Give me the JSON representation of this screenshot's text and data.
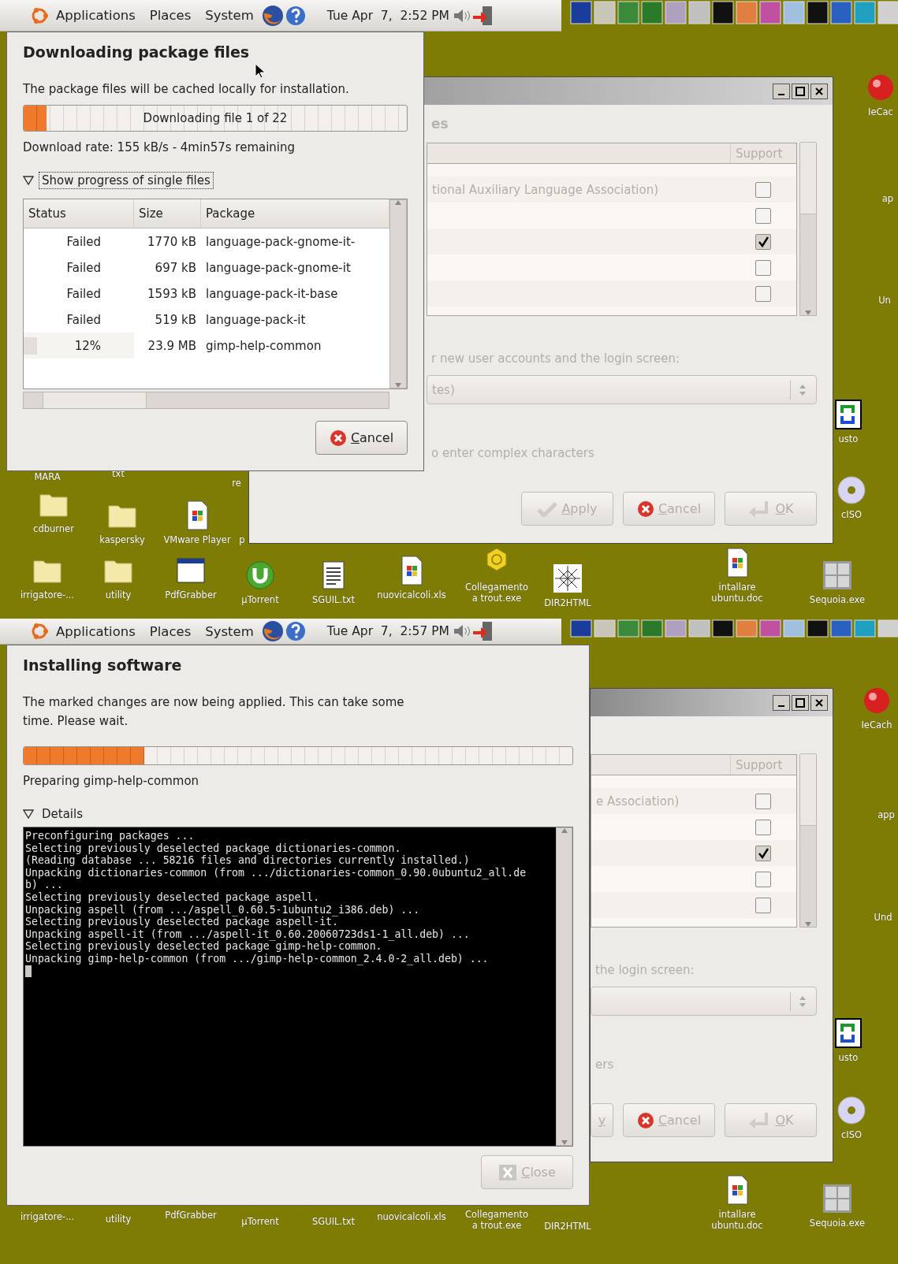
{
  "screens": [
    {
      "panel": {
        "menus": [
          "Applications",
          "Places",
          "System"
        ],
        "clock": "Tue Apr  7,  2:52 PM"
      },
      "desktop_icons": [
        {
          "label": "IeCac",
          "kind": "ball"
        },
        {
          "label": "ap",
          "kind": "none"
        },
        {
          "label": "Un",
          "kind": "none"
        },
        {
          "label": "usto",
          "kind": "logo"
        },
        {
          "label": "cISO",
          "kind": "disc"
        },
        {
          "label": "MARA",
          "kind": "none"
        },
        {
          "label": "txt",
          "kind": "none"
        },
        {
          "label": "re",
          "kind": "none"
        },
        {
          "label": "cdburner",
          "kind": "folder"
        },
        {
          "label": "kaspersky",
          "kind": "folder"
        },
        {
          "label": "VMware Player",
          "kind": "document"
        },
        {
          "label": "p",
          "kind": "none"
        },
        {
          "label": "irrigatore-...",
          "kind": "folder"
        },
        {
          "label": "utility",
          "kind": "folder"
        },
        {
          "label": "PdfGrabber",
          "kind": "window"
        },
        {
          "label": "µTorrent",
          "kind": "torrent"
        },
        {
          "label": "SGUIL.txt",
          "kind": "textfile"
        },
        {
          "label": "nuovicalcoli.xls",
          "kind": "document"
        },
        {
          "label": "Collegamento a trout.exe",
          "kind": "gear"
        },
        {
          "label": "DIR2HTML",
          "kind": "web"
        },
        {
          "label": "intallare ubuntu.doc",
          "kind": "document"
        },
        {
          "label": "Sequoia.exe",
          "kind": "grid"
        }
      ],
      "background_window": {
        "heading": "es",
        "support_header": "Support",
        "rows": [
          {
            "label": "tional Auxiliary Language Association)",
            "checked": false
          },
          {
            "checked": false
          },
          {
            "checked": true
          },
          {
            "checked": false
          },
          {
            "checked": false
          }
        ],
        "prompt": "r new user accounts and the login screen:",
        "combo_value": "tes)",
        "hint": "o enter complex characters",
        "buttons": [
          {
            "label": "Apply",
            "kind": "apply",
            "disabled": true
          },
          {
            "label": "Cancel",
            "kind": "cancel",
            "disabled": true
          },
          {
            "label": "OK",
            "kind": "ok",
            "disabled": true
          }
        ]
      },
      "dialog": {
        "kind": "download",
        "title": "Downloading package files",
        "description": "The package files will be cached locally for installation.",
        "progress": {
          "label": "Downloading file 1 of 22",
          "level": 0.06
        },
        "status": "Download rate: 155 kB/s - 4min57s remaining",
        "expander": {
          "label": "Show progress of single files",
          "expanded": true
        },
        "files": {
          "columns": [
            "Status",
            "Size",
            "Package"
          ],
          "rows": [
            {
              "status": "Failed",
              "size": "1770 kB",
              "package": "language-pack-gnome-it-"
            },
            {
              "status": "Failed",
              "size": "697 kB",
              "package": "language-pack-gnome-it"
            },
            {
              "status": "Failed",
              "size": "1593 kB",
              "package": "language-pack-it-base"
            },
            {
              "status": "Failed",
              "size": "519 kB",
              "package": "language-pack-it"
            },
            {
              "status": "12%",
              "level": 0.12,
              "size": "23.9 MB",
              "package": "gimp-help-common"
            }
          ]
        },
        "button": {
          "label": "Cancel",
          "kind": "cancel",
          "disabled": false
        }
      }
    },
    {
      "panel": {
        "menus": [
          "Applications",
          "Places",
          "System"
        ],
        "clock": "Tue Apr  7,  2:57 PM"
      },
      "desktop_icons": [
        {
          "label": "IeCach",
          "kind": "ball"
        },
        {
          "label": "app",
          "kind": "none"
        },
        {
          "label": "Und",
          "kind": "none"
        },
        {
          "label": "usto",
          "kind": "logo"
        },
        {
          "label": "cISO",
          "kind": "disc"
        },
        {
          "label": "irrigatore-...",
          "kind": "none"
        },
        {
          "label": "utility",
          "kind": "none"
        },
        {
          "label": "PdfGrabber",
          "kind": "none"
        },
        {
          "label": "µTorrent",
          "kind": "none"
        },
        {
          "label": "SGUIL.txt",
          "kind": "none"
        },
        {
          "label": "nuovicalcoli.xls",
          "kind": "none"
        },
        {
          "label": "Collegamento a trout.exe",
          "kind": "none"
        },
        {
          "label": "DIR2HTML",
          "kind": "none"
        },
        {
          "label": "intallare ubuntu.doc",
          "kind": "document"
        },
        {
          "label": "Sequoia.exe",
          "kind": "grid"
        }
      ],
      "background_window": {
        "support_header": "Support",
        "rows": [
          {
            "label": "e Association)",
            "checked": false
          },
          {
            "checked": false
          },
          {
            "checked": true
          },
          {
            "checked": false
          },
          {
            "checked": false
          }
        ],
        "prompt": "the login screen:",
        "hint": "ers",
        "buttons": [
          {
            "label": "y",
            "kind": "text",
            "disabled": true
          },
          {
            "label": "Cancel",
            "kind": "cancel",
            "disabled": true
          },
          {
            "label": "OK",
            "kind": "ok",
            "disabled": true
          }
        ]
      },
      "dialog": {
        "kind": "install",
        "title": "Installing software",
        "description": "The marked changes are now being applied. This can take some time. Please wait.",
        "progress": {
          "level": 0.22
        },
        "status": "Preparing gimp-help-common",
        "expander": {
          "label": "Details",
          "expanded": true
        },
        "terminal_lines": [
          "Preconfiguring packages ...",
          "Selecting previously deselected package dictionaries-common.",
          "(Reading database ... 58216 files and directories currently installed.)",
          "Unpacking dictionaries-common (from .../dictionaries-common_0.90.0ubuntu2_all.de",
          "b) ...",
          "Selecting previously deselected package aspell.",
          "Unpacking aspell (from .../aspell_0.60.5-1ubuntu2_i386.deb) ...",
          "Selecting previously deselected package aspell-it.",
          "Unpacking aspell-it (from .../aspell-it_0.60.20060723ds1-1_all.deb) ...",
          "Selecting previously deselected package gimp-help-common.",
          "Unpacking gimp-help-common (from .../gimp-help-common_2.4.0-2_all.deb) ..."
        ],
        "button": {
          "label": "Close",
          "kind": "close",
          "disabled": true
        }
      }
    }
  ]
}
